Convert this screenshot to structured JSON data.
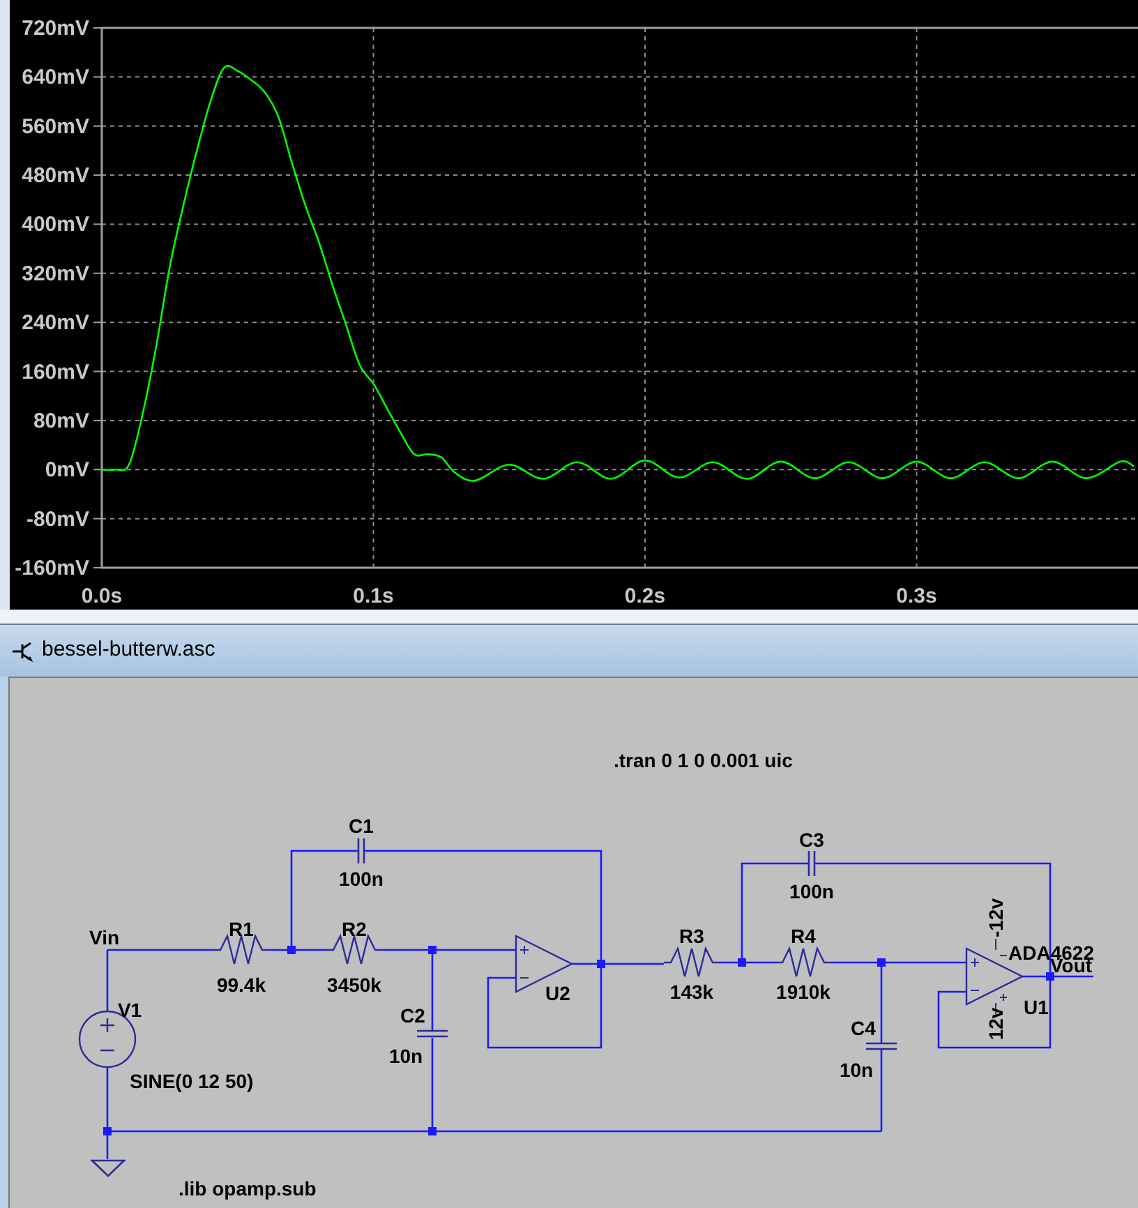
{
  "waveform_pane": {
    "chart_data": {
      "type": "line",
      "grid": true,
      "x": [
        0,
        0.005,
        0.01,
        0.015,
        0.02,
        0.025,
        0.03,
        0.035,
        0.04,
        0.045,
        0.05,
        0.055,
        0.06,
        0.065,
        0.07,
        0.075,
        0.08,
        0.085,
        0.09,
        0.095,
        0.1,
        0.105,
        0.11,
        0.115,
        0.12,
        0.125,
        0.13,
        0.1375,
        0.15,
        0.1625,
        0.175,
        0.1875,
        0.2,
        0.2125,
        0.225,
        0.2375,
        0.25,
        0.2625,
        0.275,
        0.2875,
        0.3,
        0.3125,
        0.325,
        0.3375,
        0.35,
        0.3625,
        0.375,
        0.38
      ],
      "series": [
        {
          "color": "#00ff00",
          "values": [
            0,
            0,
            8,
            90,
            200,
            330,
            430,
            520,
            600,
            655,
            650,
            635,
            615,
            575,
            500,
            430,
            370,
            300,
            235,
            170,
            140,
            100,
            60,
            25,
            25,
            20,
            -5,
            -18,
            8,
            -15,
            12,
            -15,
            15,
            -13,
            12,
            -15,
            13,
            -14,
            12,
            -14,
            13,
            -14,
            12,
            -14,
            13,
            -14,
            13,
            5
          ]
        }
      ],
      "xlim": [
        0,
        0.3815
      ],
      "ylim": [
        -160,
        720
      ],
      "xticks": [
        {
          "value": 0,
          "label": "0.0s"
        },
        {
          "value": 0.1,
          "label": "0.1s"
        },
        {
          "value": 0.2,
          "label": "0.2s"
        },
        {
          "value": 0.3,
          "label": "0.3s"
        }
      ],
      "yticks": [
        {
          "value": 720,
          "label": "720mV"
        },
        {
          "value": 640,
          "label": "640mV"
        },
        {
          "value": 560,
          "label": "560mV"
        },
        {
          "value": 480,
          "label": "480mV"
        },
        {
          "value": 400,
          "label": "400mV"
        },
        {
          "value": 320,
          "label": "320mV"
        },
        {
          "value": 240,
          "label": "240mV"
        },
        {
          "value": 160,
          "label": "160mV"
        },
        {
          "value": 80,
          "label": "80mV"
        },
        {
          "value": 0,
          "label": "0mV"
        },
        {
          "value": -80,
          "label": "-80mV"
        },
        {
          "value": -160,
          "label": "-160mV"
        }
      ]
    }
  },
  "schematic_window": {
    "title": "bessel-butterw.asc",
    "directive": ".tran 0 1 0 0.001 uic",
    "library": ".lib opamp.sub",
    "nets": [
      {
        "label": "Vin"
      },
      {
        "label": "Vout"
      }
    ],
    "components": [
      {
        "kind": "capacitor_h",
        "ref": "C1",
        "value": "100n"
      },
      {
        "kind": "capacitor_h",
        "ref": "C3",
        "value": "100n"
      },
      {
        "kind": "resistor",
        "ref": "R1",
        "value": "99.4k"
      },
      {
        "kind": "resistor",
        "ref": "R2",
        "value": "3450k"
      },
      {
        "kind": "opamp",
        "ref": "U2"
      },
      {
        "kind": "resistor",
        "ref": "R3",
        "value": "143k"
      },
      {
        "kind": "resistor",
        "ref": "R4",
        "value": "1910k"
      },
      {
        "kind": "source",
        "ref": "V1",
        "value": "SINE(0 12 50)"
      },
      {
        "kind": "opamp",
        "ref": "U1",
        "model": "ADA4622",
        "neg_supply": "-12v",
        "pos_supply": "12v"
      },
      {
        "kind": "capacitor_v",
        "ref": "C2",
        "value": "10n"
      },
      {
        "kind": "capacitor_v",
        "ref": "C4",
        "value": "10n"
      }
    ]
  }
}
